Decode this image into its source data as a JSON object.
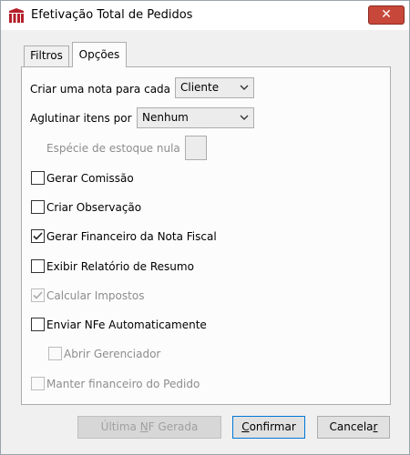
{
  "window": {
    "title": "Efetivação Total de Pedidos",
    "close_glyph": "✕"
  },
  "tabs": [
    {
      "label": "Filtros",
      "active": false
    },
    {
      "label": "Opções",
      "active": true
    }
  ],
  "options": {
    "nota_label": "Criar uma nota para cada",
    "nota_value": "Cliente",
    "aglutinar_label": "Aglutinar itens por",
    "aglutinar_value": "Nenhum",
    "especie_label": "Espécie de estoque nula",
    "especie_value": ""
  },
  "checkboxes": [
    {
      "label": "Gerar Comissão",
      "checked": false,
      "enabled": true
    },
    {
      "label": "Criar Observação",
      "checked": false,
      "enabled": true
    },
    {
      "label": "Gerar Financeiro da Nota Fiscal",
      "checked": true,
      "enabled": true
    },
    {
      "label": "Exibir Relatório de Resumo",
      "checked": false,
      "enabled": true
    },
    {
      "label": "Calcular Impostos",
      "checked": true,
      "enabled": false
    },
    {
      "label": "Enviar NFe Automaticamente",
      "checked": false,
      "enabled": true
    },
    {
      "label": "Abrir Gerenciador",
      "checked": false,
      "enabled": false
    },
    {
      "label": "Manter financeiro do Pedido",
      "checked": false,
      "enabled": false
    }
  ],
  "buttons": {
    "ultima_nf": {
      "pre": "Última ",
      "mnemonic": "N",
      "post": "F Gerada",
      "enabled": false
    },
    "confirmar": {
      "pre": "",
      "mnemonic": "C",
      "post": "onfirmar",
      "enabled": true
    },
    "cancelar": {
      "pre": "Cancela",
      "mnemonic": "r",
      "post": "",
      "enabled": true
    }
  },
  "colors": {
    "close_button": "#c7483a",
    "app_icon": "#b5202a",
    "focus_border": "#0078d7"
  }
}
